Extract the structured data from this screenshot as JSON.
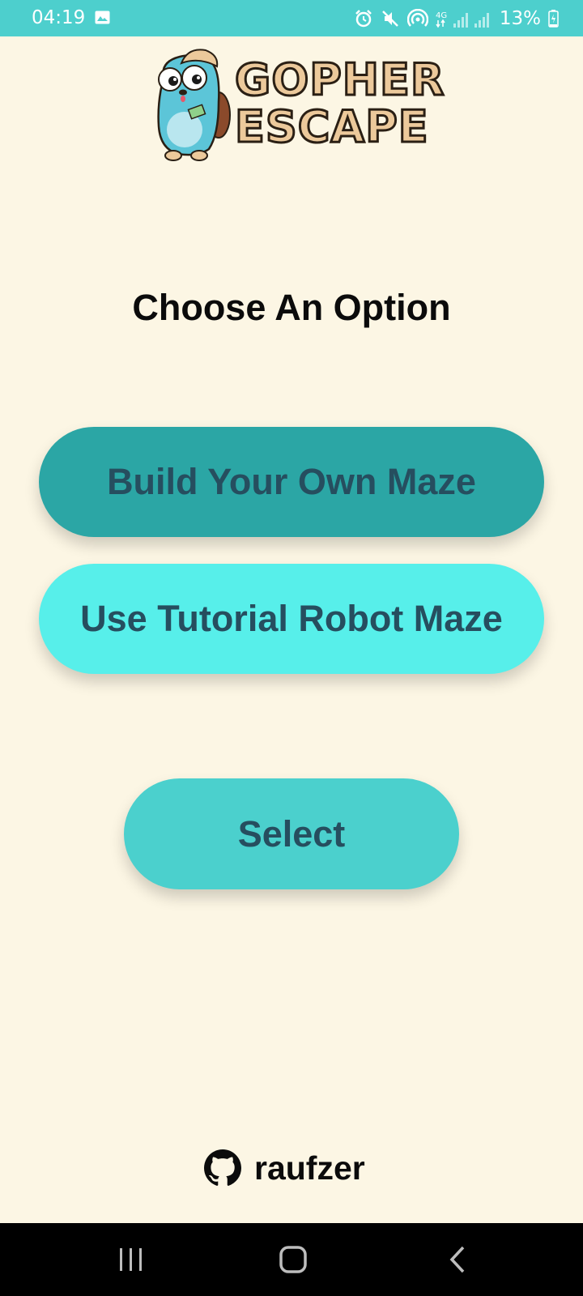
{
  "status_bar": {
    "time": "04:19",
    "battery": "13%",
    "network": "4G",
    "icons": [
      "gallery-icon",
      "alarm-icon",
      "mute-icon",
      "hotspot-icon",
      "signal-icon",
      "battery-charging-icon"
    ]
  },
  "logo": {
    "line1": "GOPHER",
    "line2": "ESCAPE"
  },
  "heading": "Choose An Option",
  "options": [
    {
      "label": "Build Your Own Maze",
      "color": "#2ba6a5"
    },
    {
      "label": "Use Tutorial Robot Maze",
      "color": "#57efea"
    }
  ],
  "select_button": {
    "label": "Select",
    "color": "#4bd0cd"
  },
  "footer": {
    "github_user": "raufzer",
    "icon": "github-icon"
  },
  "nav_bar": {
    "icons": [
      "recent-apps-icon",
      "home-icon",
      "back-icon"
    ]
  },
  "colors": {
    "background": "#fcf6e4",
    "status_bar": "#4dcfcd",
    "button_text": "#264e5f"
  }
}
